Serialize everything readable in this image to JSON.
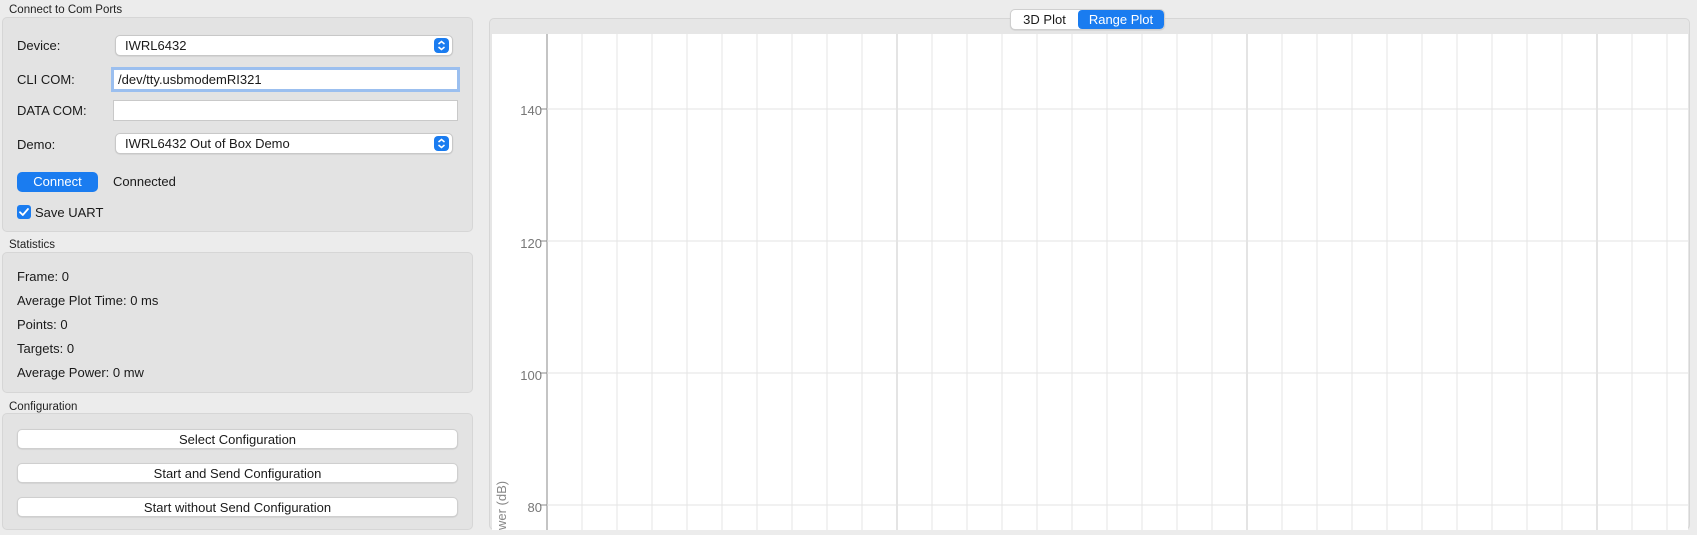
{
  "connect_group": {
    "title": "Connect to Com Ports",
    "device_label": "Device:",
    "device_value": "IWRL6432",
    "cli_label": "CLI COM:",
    "cli_value": "/dev/tty.usbmodemRI321",
    "data_label": "DATA COM:",
    "data_value": "",
    "demo_label": "Demo:",
    "demo_value": "IWRL6432 Out of Box Demo",
    "connect_button": "Connect",
    "status": "Connected",
    "save_uart_label": "Save UART",
    "save_uart_checked": true
  },
  "statistics": {
    "title": "Statistics",
    "frame": "Frame: 0",
    "avg_plot_time": "Average Plot Time: 0 ms",
    "points": "Points: 0",
    "targets": "Targets: 0",
    "avg_power": "Average Power: 0 mw"
  },
  "configuration": {
    "title": "Configuration",
    "select_config": "Select Configuration",
    "start_send": "Start and Send Configuration",
    "start_without": "Start without Send Configuration"
  },
  "plot_tabs": [
    {
      "label": "3D Plot",
      "active": false
    },
    {
      "label": "Range Plot",
      "active": true
    }
  ],
  "chart_data": {
    "type": "line",
    "title": "",
    "xlabel": "",
    "ylabel": "wer (dB)",
    "y_ticks": [
      140,
      120,
      100,
      80
    ],
    "series": [],
    "grid": true
  },
  "colors": {
    "accent": "#1a7cf0",
    "panel": "#e3e3e3",
    "background": "#ececec"
  }
}
